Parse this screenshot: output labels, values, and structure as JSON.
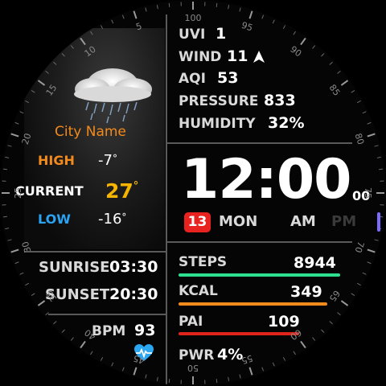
{
  "weather": {
    "city": "City Name",
    "high_label": "HIGH",
    "high_value": "-7",
    "current_label": "CURRENT",
    "current_value": "27",
    "low_label": "LOW",
    "low_value": "-16",
    "degree": "°",
    "icon": "rain-cloud-icon"
  },
  "env": {
    "uvi_label": "UVI",
    "uvi_value": "1",
    "wind_label": "WIND",
    "wind_value": "11",
    "aqi_label": "AQI",
    "aqi_value": "53",
    "pressure_label": "PRESSURE",
    "pressure_value": "833",
    "humidity_label": "HUMIDITY",
    "humidity_value": "32%"
  },
  "time": {
    "hours": "12",
    "colon": ":",
    "minutes": "00",
    "seconds": "00",
    "day_num": "13",
    "weekday": "MON",
    "am": "AM",
    "pm": "PM"
  },
  "sun": {
    "sunrise_label": "SUNRISE",
    "sunrise_value": "03:30",
    "sunset_label": "SUNSET",
    "sunset_value": "20:30"
  },
  "health": {
    "bpm_label": "BPM",
    "bpm_value": "93",
    "steps_label": "STEPS",
    "steps_value": "8944",
    "steps_progress": 0.98,
    "kcal_label": "KCAL",
    "kcal_value": "349",
    "kcal_progress": 0.9,
    "pai_label": "PAI",
    "pai_value": "109",
    "pai_progress": 0.73,
    "pwr_label": "PWR",
    "pwr_value": "4%"
  },
  "bezel": {
    "labels": [
      "5",
      "10",
      "15",
      "20",
      "25",
      "30",
      "35",
      "40",
      "45",
      "50",
      "55",
      "60",
      "65",
      "70",
      "75",
      "80",
      "85",
      "90",
      "95",
      "100"
    ]
  },
  "colors": {
    "orange": "#f28a1c",
    "gold": "#f5b400",
    "blue": "#29a3f2",
    "steps_bar": "#2de08f",
    "kcal_bar": "#f28a1c",
    "pai_bar": "#e0241b",
    "day_badge": "#e8231f",
    "heart": "#2aa7f0",
    "crown": "#7b6cff"
  }
}
